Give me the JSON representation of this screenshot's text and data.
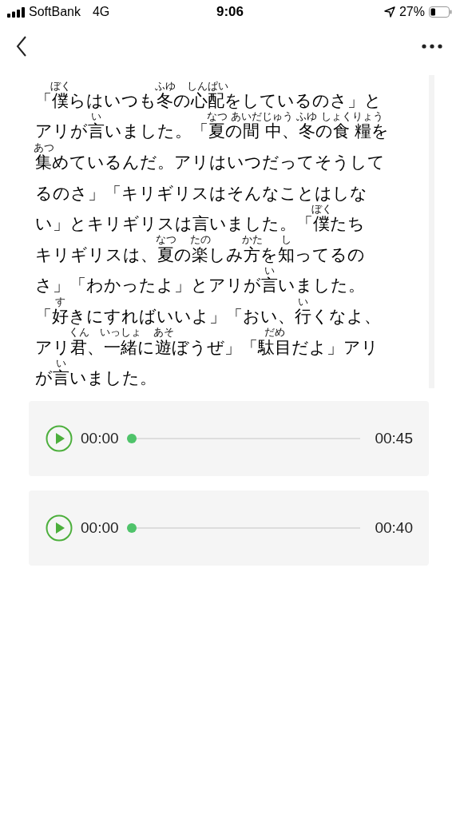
{
  "status_bar": {
    "carrier": "SoftBank",
    "network": "4G",
    "time": "9:06",
    "battery": "27%"
  },
  "story": {
    "lines": [
      [
        {
          "text": "「"
        },
        {
          "text": "僕",
          "ruby": "ぼく"
        },
        {
          "text": "らはいつも"
        },
        {
          "text": "冬",
          "ruby": "ふゆ"
        },
        {
          "text": "の"
        },
        {
          "text": "心配",
          "ruby": "しんぱい"
        },
        {
          "text": "をしているのさ」と"
        }
      ],
      [
        {
          "text": "アリが"
        },
        {
          "text": "言",
          "ruby": "い"
        },
        {
          "text": "いました。「"
        },
        {
          "text": "夏",
          "ruby": "なつ"
        },
        {
          "text": "の"
        },
        {
          "text": "間 中",
          "ruby": "あいだじゅう"
        },
        {
          "text": "、"
        },
        {
          "text": "冬",
          "ruby": "ふゆ"
        },
        {
          "text": "の"
        },
        {
          "text": "食 糧",
          "ruby": "しょくりょう"
        },
        {
          "text": "を"
        }
      ],
      [
        {
          "text": "集",
          "ruby": "あつ"
        },
        {
          "text": "めているんだ。アリはいつだってそうして"
        }
      ],
      [
        {
          "text": "るのさ」「キリギリスはそんなことはしな"
        }
      ],
      [
        {
          "text": "い」とキリギリスは言いました。「"
        },
        {
          "text": "僕",
          "ruby": "ぼく"
        },
        {
          "text": "たち"
        }
      ],
      [
        {
          "text": "キリギリスは、"
        },
        {
          "text": "夏",
          "ruby": "なつ"
        },
        {
          "text": "の"
        },
        {
          "text": "楽",
          "ruby": "たの"
        },
        {
          "text": "しみ"
        },
        {
          "text": "方",
          "ruby": "かた"
        },
        {
          "text": "を"
        },
        {
          "text": "知",
          "ruby": "し"
        },
        {
          "text": "ってるの"
        }
      ],
      [
        {
          "text": "さ」「わかったよ」とアリが"
        },
        {
          "text": "言",
          "ruby": "い"
        },
        {
          "text": "いました。"
        }
      ],
      [
        {
          "text": "「"
        },
        {
          "text": "好",
          "ruby": "す"
        },
        {
          "text": "きにすればいいよ」「おい、"
        },
        {
          "text": "行",
          "ruby": "い"
        },
        {
          "text": "くなよ、"
        }
      ],
      [
        {
          "text": "アリ"
        },
        {
          "text": "君",
          "ruby": "くん"
        },
        {
          "text": "、"
        },
        {
          "text": "一緒",
          "ruby": "いっしょ"
        },
        {
          "text": "に"
        },
        {
          "text": "遊",
          "ruby": "あそ"
        },
        {
          "text": "ぼうぜ」「"
        },
        {
          "text": "駄目",
          "ruby": "だめ"
        },
        {
          "text": "だよ」アリ"
        }
      ],
      [
        {
          "text": "が"
        },
        {
          "text": "言",
          "ruby": "い"
        },
        {
          "text": "いました。"
        }
      ]
    ]
  },
  "players": [
    {
      "current": "00:00",
      "level": 0,
      "duration": "00:45"
    },
    {
      "current": "00:00",
      "level": 0,
      "duration": "00:40"
    }
  ]
}
